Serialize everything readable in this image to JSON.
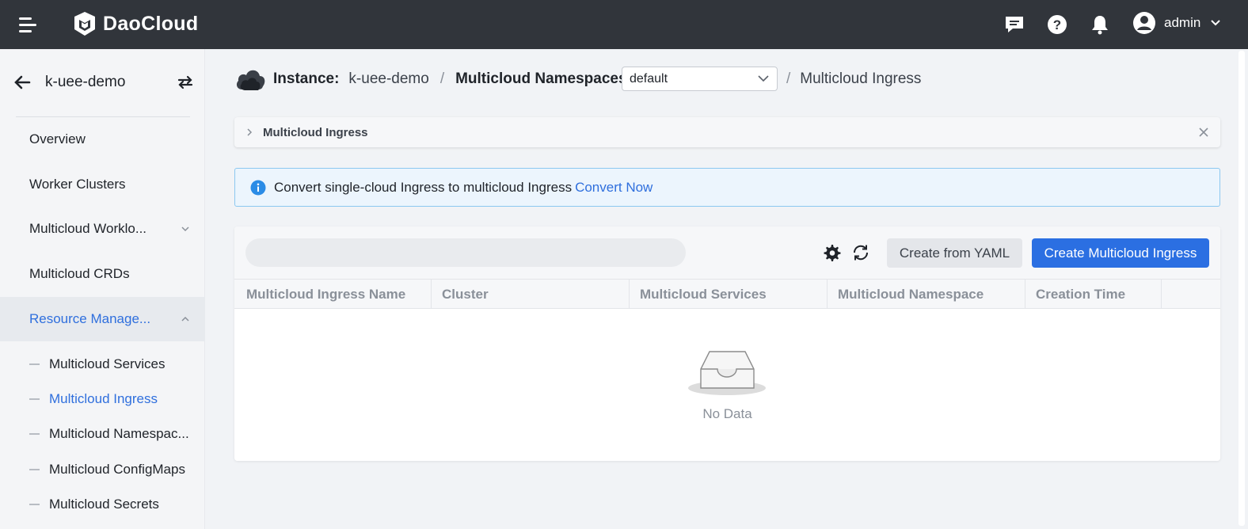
{
  "topbar": {
    "brand": "DaoCloud",
    "user": "admin"
  },
  "sidebar": {
    "instance_name": "k-uee-demo",
    "items": [
      {
        "label": "Overview"
      },
      {
        "label": "Worker Clusters"
      },
      {
        "label": "Multicloud Worklo..."
      },
      {
        "label": "Multicloud CRDs"
      },
      {
        "label": "Resource Manage..."
      }
    ],
    "sub_items": [
      {
        "label": "Multicloud Services"
      },
      {
        "label": "Multicloud Ingress"
      },
      {
        "label": "Multicloud Namespac..."
      },
      {
        "label": "Multicloud ConfigMaps"
      },
      {
        "label": "Multicloud Secrets"
      }
    ]
  },
  "breadcrumb": {
    "instance_label": "Instance:",
    "instance_value": "k-uee-demo",
    "sep": "/",
    "namespace_label": "Multicloud Namespaces:",
    "namespace_value": "default",
    "current": "Multicloud Ingress"
  },
  "collapse": {
    "title": "Multicloud Ingress"
  },
  "alert": {
    "text": "Convert single-cloud Ingress to multicloud Ingress",
    "link": "Convert Now"
  },
  "toolbar": {
    "search_placeholder": "",
    "create_yaml": "Create from YAML",
    "create_primary": "Create Multicloud Ingress"
  },
  "table": {
    "columns": [
      "Multicloud Ingress Name",
      "Cluster",
      "Multicloud Services",
      "Multicloud Namespace",
      "Creation Time"
    ],
    "empty_text": "No Data"
  },
  "colors": {
    "topbar": "#31353b",
    "accent": "#2b6fe2",
    "link": "#2f6fdd"
  }
}
